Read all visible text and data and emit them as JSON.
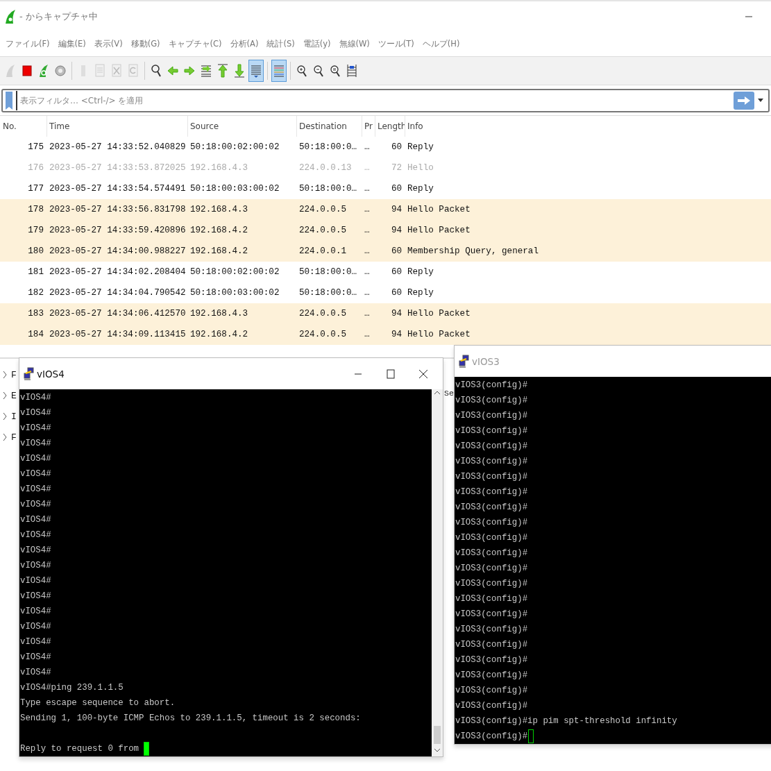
{
  "window": {
    "title": "- からキャプチャ中"
  },
  "menu": [
    "ファイル(F)",
    "編集(E)",
    "表示(V)",
    "移動(G)",
    "キャプチャ(C)",
    "分析(A)",
    "統計(S)",
    "電話(y)",
    "無線(W)",
    "ツール(T)",
    "ヘルプ(H)"
  ],
  "toolbar": [
    {
      "buttons": [
        {
          "kind": "start",
          "disabled": true,
          "pressed": false
        },
        {
          "kind": "stop",
          "disabled": false,
          "pressed": false
        },
        {
          "kind": "restart",
          "disabled": false,
          "pressed": false
        },
        {
          "kind": "options",
          "disabled": false,
          "pressed": false
        }
      ]
    },
    {
      "buttons": [
        {
          "kind": "open",
          "disabled": true,
          "pressed": false
        },
        {
          "kind": "save",
          "disabled": true,
          "pressed": false
        },
        {
          "kind": "close",
          "disabled": true,
          "pressed": false
        },
        {
          "kind": "reload",
          "disabled": true,
          "pressed": false
        }
      ]
    },
    {
      "buttons": [
        {
          "kind": "find",
          "disabled": false,
          "pressed": false
        },
        {
          "kind": "back",
          "disabled": false,
          "pressed": false
        },
        {
          "kind": "forward",
          "disabled": false,
          "pressed": false
        },
        {
          "kind": "goto",
          "disabled": false,
          "pressed": false
        },
        {
          "kind": "first",
          "disabled": false,
          "pressed": false
        },
        {
          "kind": "last",
          "disabled": false,
          "pressed": false
        },
        {
          "kind": "autoscroll",
          "disabled": false,
          "pressed": true
        }
      ]
    },
    {
      "buttons": [
        {
          "kind": "colorize",
          "disabled": false,
          "pressed": true
        }
      ]
    },
    {
      "buttons": [
        {
          "kind": "zoom_in",
          "disabled": false,
          "pressed": false
        },
        {
          "kind": "zoom_out",
          "disabled": false,
          "pressed": false
        },
        {
          "kind": "zoom_reset",
          "disabled": false,
          "pressed": false
        },
        {
          "kind": "resize_columns",
          "disabled": false,
          "pressed": false
        }
      ]
    }
  ],
  "filter": {
    "placeholder": "表示フィルタ… <Ctrl-/> を適用"
  },
  "packet_list": {
    "columns": [
      "No.",
      "Time",
      "Source",
      "Destination",
      "Pr",
      "Length",
      "Info"
    ],
    "rows": [
      {
        "cells": [
          "175",
          "2023-05-27 14:33:52.040829",
          "50:18:00:02:00:02",
          "50:18:00:0…",
          "…",
          "60",
          "Reply"
        ],
        "color": "#ffffff",
        "dimmed": false
      },
      {
        "cells": [
          "176",
          "2023-05-27 14:33:53.872025",
          "192.168.4.3",
          "224.0.0.13",
          "…",
          "72",
          "Hello"
        ],
        "color": "#ffffff",
        "dimmed": true
      },
      {
        "cells": [
          "177",
          "2023-05-27 14:33:54.574491",
          "50:18:00:03:00:02",
          "50:18:00:0…",
          "…",
          "60",
          "Reply"
        ],
        "color": "#ffffff",
        "dimmed": false
      },
      {
        "cells": [
          "178",
          "2023-05-27 14:33:56.831798",
          "192.168.4.3",
          "224.0.0.5",
          "…",
          "94",
          "Hello Packet"
        ],
        "color": "#fdf1d9",
        "dimmed": false
      },
      {
        "cells": [
          "179",
          "2023-05-27 14:33:59.420896",
          "192.168.4.2",
          "224.0.0.5",
          "…",
          "94",
          "Hello Packet"
        ],
        "color": "#fdf1d9",
        "dimmed": false
      },
      {
        "cells": [
          "180",
          "2023-05-27 14:34:00.988227",
          "192.168.4.2",
          "224.0.0.1",
          "…",
          "60",
          "Membership Query, general"
        ],
        "color": "#fdf1d9",
        "dimmed": false
      },
      {
        "cells": [
          "181",
          "2023-05-27 14:34:02.208404",
          "50:18:00:02:00:02",
          "50:18:00:0…",
          "…",
          "60",
          "Reply"
        ],
        "color": "#ffffff",
        "dimmed": false
      },
      {
        "cells": [
          "182",
          "2023-05-27 14:34:04.790542",
          "50:18:00:03:00:02",
          "50:18:00:0…",
          "…",
          "60",
          "Reply"
        ],
        "color": "#ffffff",
        "dimmed": false
      },
      {
        "cells": [
          "183",
          "2023-05-27 14:34:06.412570",
          "192.168.4.3",
          "224.0.0.5",
          "…",
          "94",
          "Hello Packet"
        ],
        "color": "#fdf1d9",
        "dimmed": false
      },
      {
        "cells": [
          "184",
          "2023-05-27 14:34:09.113415",
          "192.168.4.2",
          "224.0.0.5",
          "…",
          "94",
          "Hello Packet"
        ],
        "color": "#fdf1d9",
        "dimmed": false
      }
    ]
  },
  "detail_pane": {
    "rows": [
      {
        "text": "F",
        "expanded": false
      },
      {
        "text": "E",
        "expanded": false
      },
      {
        "text": "I",
        "expanded": false
      },
      {
        "text": "F",
        "expanded": false
      }
    ],
    "fragment": "Se"
  },
  "terminals": [
    {
      "title": "vIOS4",
      "active": true,
      "cursor_filled": true,
      "lines": [
        {
          "kind": "text",
          "text": "vIOS4#"
        },
        {
          "kind": "text",
          "text": "vIOS4#"
        },
        {
          "kind": "text",
          "text": "vIOS4#"
        },
        {
          "kind": "text",
          "text": "vIOS4#"
        },
        {
          "kind": "text",
          "text": "vIOS4#"
        },
        {
          "kind": "text",
          "text": "vIOS4#"
        },
        {
          "kind": "text",
          "text": "vIOS4#"
        },
        {
          "kind": "text",
          "text": "vIOS4#"
        },
        {
          "kind": "text",
          "text": "vIOS4#"
        },
        {
          "kind": "text",
          "text": "vIOS4#"
        },
        {
          "kind": "text",
          "text": "vIOS4#"
        },
        {
          "kind": "text",
          "text": "vIOS4#"
        },
        {
          "kind": "text",
          "text": "vIOS4#"
        },
        {
          "kind": "text",
          "text": "vIOS4#"
        },
        {
          "kind": "text",
          "text": "vIOS4#"
        },
        {
          "kind": "text",
          "text": "vIOS4#"
        },
        {
          "kind": "text",
          "text": "vIOS4#"
        },
        {
          "kind": "text",
          "text": "vIOS4#"
        },
        {
          "kind": "text",
          "text": "vIOS4#"
        },
        {
          "kind": "text",
          "text": "vIOS4#ping 239.1.1.5"
        },
        {
          "kind": "text",
          "text": "Type escape sequence to abort."
        },
        {
          "kind": "text",
          "text": "Sending 1, 100-byte ICMP Echos to 239.1.1.5, timeout is 2 seconds:"
        },
        {
          "kind": "blank"
        },
        {
          "kind": "text",
          "text": "Reply to request 0 from"
        }
      ]
    },
    {
      "title": "vIOS3",
      "active": false,
      "cursor_filled": false,
      "lines": [
        {
          "kind": "text",
          "text": "vIOS3(config)#"
        },
        {
          "kind": "text",
          "text": "vIOS3(config)#"
        },
        {
          "kind": "text",
          "text": "vIOS3(config)#"
        },
        {
          "kind": "text",
          "text": "vIOS3(config)#"
        },
        {
          "kind": "text",
          "text": "vIOS3(config)#"
        },
        {
          "kind": "text",
          "text": "vIOS3(config)#"
        },
        {
          "kind": "text",
          "text": "vIOS3(config)#"
        },
        {
          "kind": "text",
          "text": "vIOS3(config)#"
        },
        {
          "kind": "text",
          "text": "vIOS3(config)#"
        },
        {
          "kind": "text",
          "text": "vIOS3(config)#"
        },
        {
          "kind": "text",
          "text": "vIOS3(config)#"
        },
        {
          "kind": "text",
          "text": "vIOS3(config)#"
        },
        {
          "kind": "text",
          "text": "vIOS3(config)#"
        },
        {
          "kind": "text",
          "text": "vIOS3(config)#"
        },
        {
          "kind": "text",
          "text": "vIOS3(config)#"
        },
        {
          "kind": "text",
          "text": "vIOS3(config)#"
        },
        {
          "kind": "text",
          "text": "vIOS3(config)#"
        },
        {
          "kind": "text",
          "text": "vIOS3(config)#"
        },
        {
          "kind": "text",
          "text": "vIOS3(config)#"
        },
        {
          "kind": "text",
          "text": "vIOS3(config)#"
        },
        {
          "kind": "text",
          "text": "vIOS3(config)#"
        },
        {
          "kind": "text",
          "text": "vIOS3(config)#"
        },
        {
          "kind": "text",
          "text": "vIOS3(config)#ip pim spt-threshold infinity"
        },
        {
          "kind": "text",
          "text": "vIOS3(config)#"
        }
      ]
    }
  ]
}
